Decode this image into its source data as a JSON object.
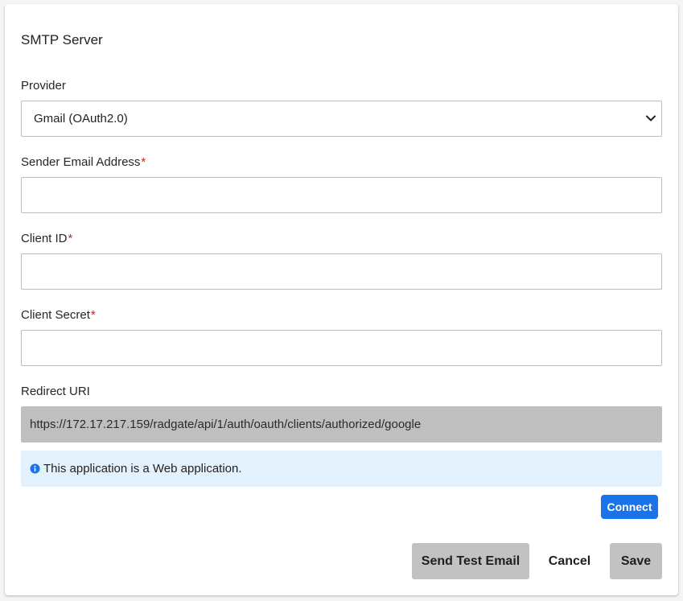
{
  "section_title": "SMTP Server",
  "provider": {
    "label": "Provider",
    "selected": "Gmail (OAuth2.0)"
  },
  "sender_email": {
    "label": "Sender Email Address",
    "required_mark": "*",
    "value": ""
  },
  "client_id": {
    "label": "Client ID",
    "required_mark": "*",
    "value": ""
  },
  "client_secret": {
    "label": "Client Secret",
    "required_mark": "*",
    "value": ""
  },
  "redirect_uri": {
    "label": "Redirect URI",
    "value": "https://172.17.217.159/radgate/api/1/auth/oauth/clients/authorized/google"
  },
  "info_message": "This application is a Web application.",
  "buttons": {
    "connect": "Connect",
    "send_test_email": "Send Test Email",
    "cancel": "Cancel",
    "save": "Save"
  },
  "icons": {
    "info": "info-icon",
    "dropdown": "chevron-down-icon"
  },
  "colors": {
    "accent": "#1a73e8",
    "required": "#c62828",
    "info_background": "#e3f1fd",
    "readonly_background": "#bfbfbf",
    "button_grey": "#c2c2c2"
  }
}
